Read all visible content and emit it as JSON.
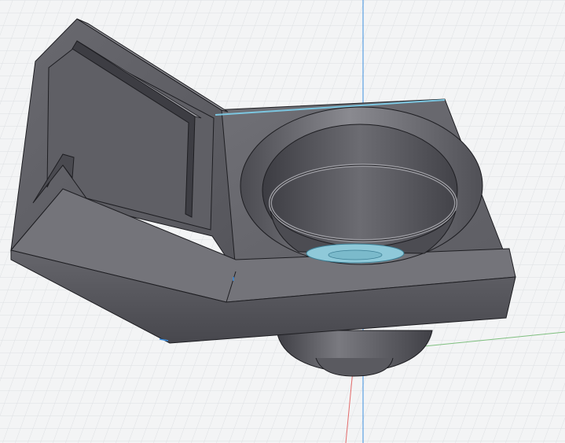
{
  "viewport": {
    "background_color": "#f3f4f5",
    "grid_minor_color": "#d9dcdf",
    "grid_major_color": "#c3c7cc"
  },
  "axes": {
    "x_axis_color": "#7fbf7f",
    "y_axis_color": "#e36b6b",
    "z_axis_color": "#3d8fe0"
  },
  "model": {
    "name_icon": "cup-holder-with-slot-3d-model",
    "body_color": "#5a5a60",
    "edge_color": "#1e1e22",
    "selection_highlight_color": "#7cc6e0"
  }
}
